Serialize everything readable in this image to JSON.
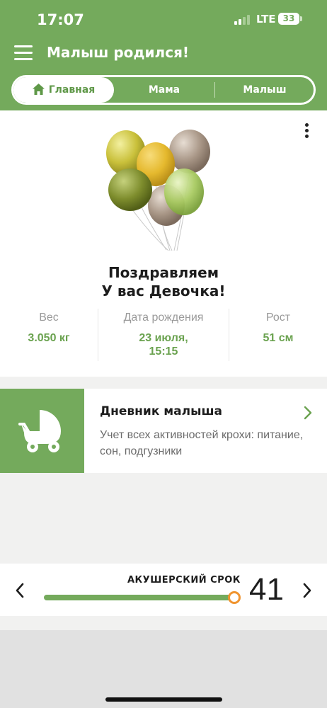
{
  "status_bar": {
    "time": "17:07",
    "network": "LTE",
    "battery": "33"
  },
  "header": {
    "title": "Малыш родился!"
  },
  "tabs": [
    {
      "label": "Главная",
      "active": true,
      "icon": "home-icon"
    },
    {
      "label": "Мама",
      "active": false
    },
    {
      "label": "Малыш",
      "active": false
    }
  ],
  "main": {
    "congrats_line1": "Поздравляем",
    "congrats_line2": "У вас Девочка!",
    "stats": {
      "weight_label": "Вес",
      "weight_value": "3.050 кг",
      "birth_label": "Дата рождения",
      "birth_date": "23 июля,",
      "birth_time": "15:15",
      "height_label": "Рост",
      "height_value": "51 см"
    }
  },
  "diary": {
    "title": "Дневник малыша",
    "description": "Учет всех активностей крохи: питание, сон, подгузники",
    "icon": "baby-stroller-icon"
  },
  "term": {
    "label": "АКУШЕРСКИЙ СРОК",
    "value": "41",
    "progress": 1.0
  },
  "colors": {
    "brand_green": "#74aa5c",
    "accent_text_green": "#6aa24f",
    "knob_orange": "#f0942f"
  }
}
